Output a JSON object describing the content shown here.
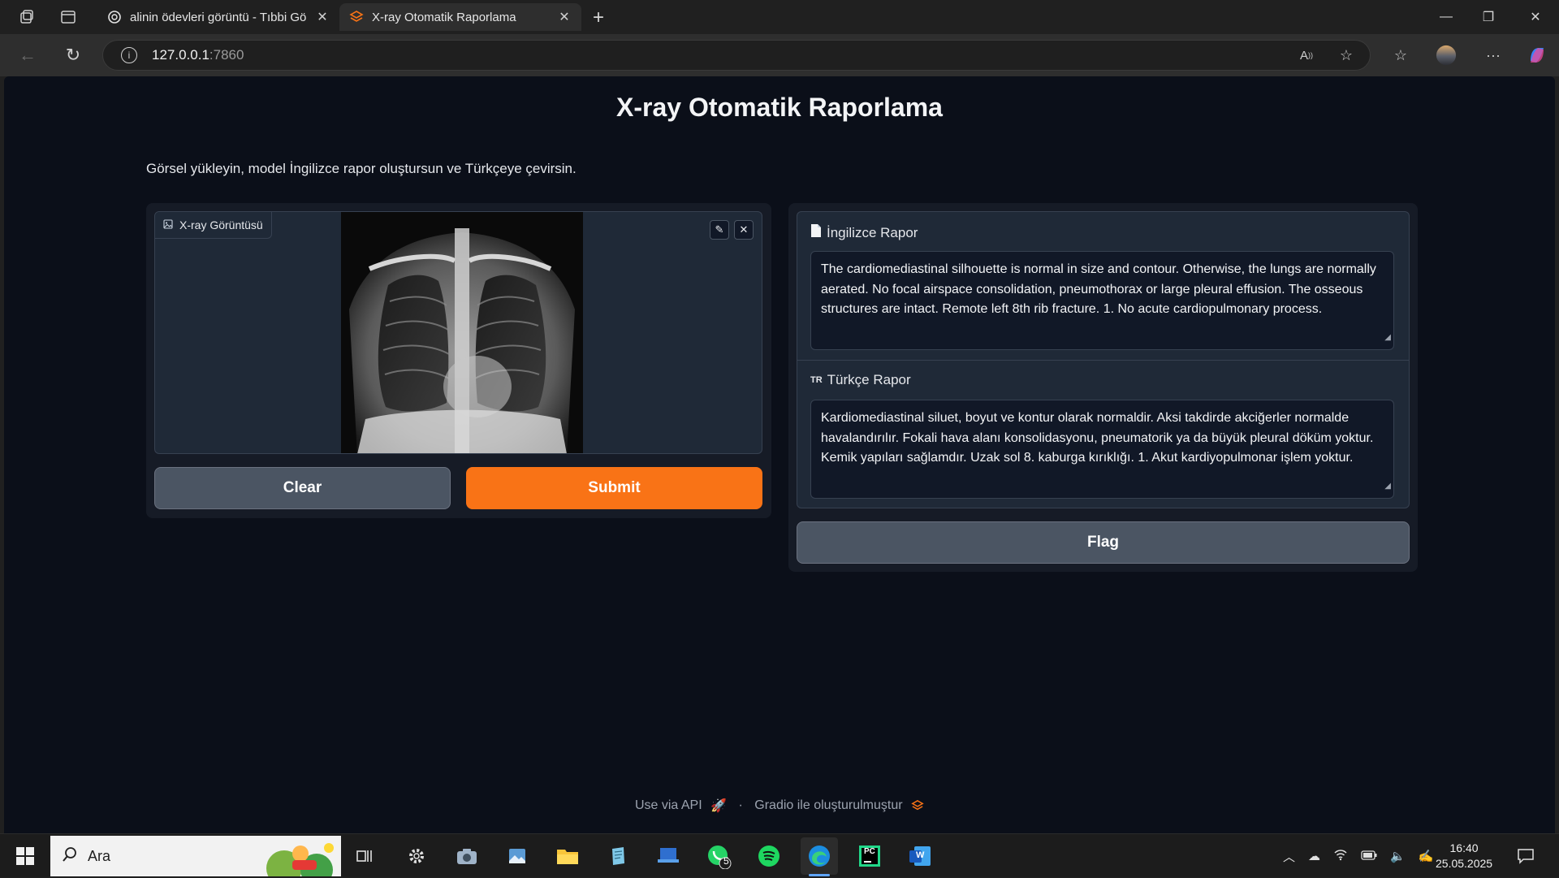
{
  "browser": {
    "tabs": [
      {
        "title": "alinin ödevleri görüntü - Tıbbi Gö",
        "active": false
      },
      {
        "title": "X-ray Otomatik Raporlama",
        "active": true
      }
    ],
    "url_host": "127.0.0.1",
    "url_port": ":7860"
  },
  "app": {
    "title": "X-ray Otomatik Raporlama",
    "description": "Görsel yükleyin, model İngilizce rapor oluştursun ve Türkçeye çevirsin.",
    "image_input": {
      "label": "X-ray Görüntüsü"
    },
    "buttons": {
      "clear": "Clear",
      "submit": "Submit",
      "flag": "Flag"
    },
    "english_report": {
      "label": "İngilizce Rapor",
      "text": "The cardiomediastinal silhouette is normal in size and contour. Otherwise, the lungs are normally aerated. No focal airspace consolidation, pneumothorax or large pleural effusion. The osseous structures are intact. Remote left 8th rib fracture. 1. No acute cardiopulmonary process."
    },
    "turkish_report": {
      "label": "Türkçe Rapor",
      "prefix": "TR",
      "text": "Kardiomediastinal siluet, boyut ve kontur olarak normaldir. Aksi takdirde akciğerler normalde havalandırılır. Fokali hava alanı konsolidasyonu, pneumatorik ya da büyük pleural döküm yoktur. Kemik yapıları sağlamdır. Uzak sol 8. kaburga kırıklığı. 1. Akut kardiyopulmonar işlem yoktur."
    },
    "footer": {
      "api": "Use via API",
      "separator": "·",
      "built_with": "Gradio ile oluşturulmuştur"
    }
  },
  "taskbar": {
    "search_placeholder": "Ara",
    "whatsapp_badge": "5",
    "time": "16:40",
    "date": "25.05.2025"
  },
  "colors": {
    "page_bg": "#0b0f19",
    "panel_bg": "#161b26",
    "submit": "#f97316",
    "secondary_button": "#4b5563"
  }
}
